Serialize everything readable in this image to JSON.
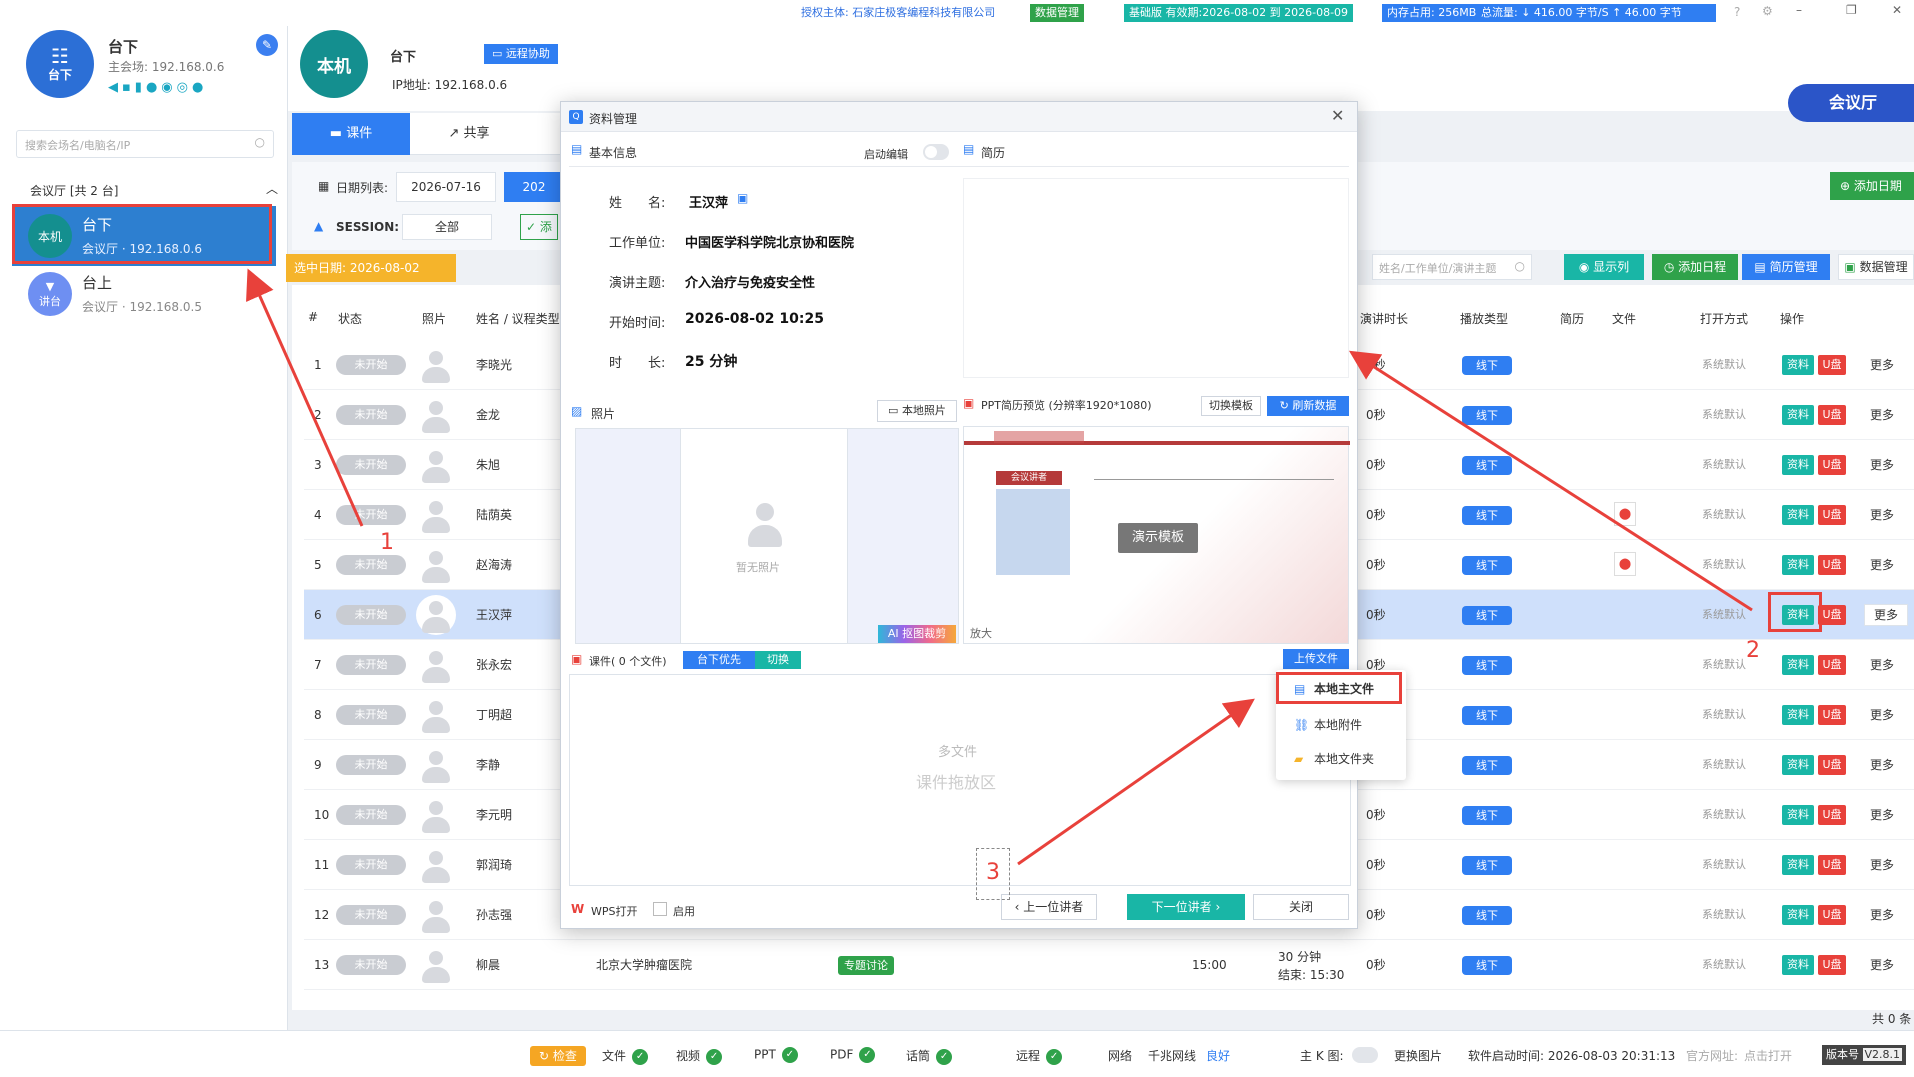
{
  "topbar": {
    "license": "授权主体: 石家庄极客编程科技有限公司",
    "data_mgmt": "数据管理",
    "edition": "基础版 有效期:2026-08-02 到 2026-08-09",
    "memory": "内存占用: 256MB",
    "traffic": "总流量: ↓ 416.00 字节/S ↑ 46.00 字节"
  },
  "sidebar": {
    "logo_label": "台下",
    "title": "台下",
    "main_venue": "主会场: 192.168.0.6",
    "search_placeholder": "搜索会场名/电脑名/IP",
    "group_title": "会议厅 [共 2 台]",
    "devices": [
      {
        "badge": "本机",
        "name": "台下",
        "sub": "会议厅 · 192.168.0.6"
      },
      {
        "badge": "讲台",
        "name": "台上",
        "sub": "会议厅 · 192.168.0.5"
      }
    ]
  },
  "header": {
    "badge": "本机",
    "name": "台下",
    "remote": "远程协助",
    "ip": "IP地址: 192.168.0.6",
    "hall_button": "会议厅"
  },
  "tabs": [
    {
      "label": "课件"
    },
    {
      "label": "共享"
    }
  ],
  "filter": {
    "date_label": "日期列表:",
    "date_value": "2026-07-16",
    "date2": "202",
    "add_date": "添加日期",
    "session_label": "SESSION:",
    "session_value": "全部",
    "add": "添",
    "selected_date": "选中日期: 2026-08-02",
    "search_placeholder": "姓名/工作单位/演讲主题",
    "show_cols": "显示列",
    "add_schedule": "添加日程",
    "resume_mgmt": "简历管理",
    "data_mgmt": "数据管理"
  },
  "table": {
    "headers": {
      "no": "#",
      "status": "状态",
      "photo": "照片",
      "name": "姓名 / 议程类型",
      "duration": "演讲时长",
      "play": "播放类型",
      "resume": "简历",
      "file": "文件",
      "open": "打开方式",
      "ops": "操作"
    },
    "rows": [
      {
        "no": "1",
        "status": "未开始",
        "name": "李晓光",
        "dur": "0秒",
        "play": "线下",
        "open": "系统默认"
      },
      {
        "no": "2",
        "status": "未开始",
        "name": "金龙",
        "dur": "0秒",
        "play": "线下",
        "open": "系统默认"
      },
      {
        "no": "3",
        "status": "未开始",
        "name": "朱旭",
        "dur": "0秒",
        "play": "线下",
        "open": "系统默认"
      },
      {
        "no": "4",
        "status": "未开始",
        "name": "陆荫英",
        "dur": "0秒",
        "play": "线下",
        "open": "系统默认"
      },
      {
        "no": "5",
        "status": "未开始",
        "name": "赵海涛",
        "dur": "0秒",
        "play": "线下",
        "open": "系统默认"
      },
      {
        "no": "6",
        "status": "未开始",
        "name": "王汉萍",
        "dur": "0秒",
        "play": "线下",
        "open": "系统默认"
      },
      {
        "no": "7",
        "status": "未开始",
        "name": "张永宏",
        "dur": "0秒",
        "play": "线下",
        "open": "系统默认"
      },
      {
        "no": "8",
        "status": "未开始",
        "name": "丁明超",
        "dur": "0秒",
        "play": "线下",
        "open": "系统默认"
      },
      {
        "no": "9",
        "status": "未开始",
        "name": "李静",
        "dur": "0秒",
        "play": "线下",
        "open": "系统默认"
      },
      {
        "no": "10",
        "status": "未开始",
        "name": "李元明",
        "dur": "0秒",
        "play": "线下",
        "open": "系统默认"
      },
      {
        "no": "11",
        "status": "未开始",
        "name": "郭润琦",
        "dur": "0秒",
        "play": "线下",
        "open": "系统默认"
      },
      {
        "no": "12",
        "status": "未开始",
        "name": "孙志强",
        "dur": "0秒",
        "play": "线下",
        "open": "系统默认"
      },
      {
        "no": "13",
        "status": "未开始",
        "name": "柳晨",
        "dur": "0秒",
        "play": "线下",
        "open": "系统默认",
        "org": "北京大学肿瘤医院",
        "tag": "专题讨论",
        "time": "15:00",
        "len": "30 分钟",
        "end": "结束: 15:30"
      }
    ],
    "btn_zl": "资料",
    "btn_up": "U盘",
    "more": "更多",
    "total": "共 0 条"
  },
  "modal": {
    "title": "资料管理",
    "basic_info": "基本信息",
    "enable_edit": "启动编辑",
    "resume": "简历",
    "fields": {
      "name_l": "姓　　名:",
      "name_v": "王汉萍",
      "org_l": "工作单位:",
      "org_v": "中国医学科学院北京协和医院",
      "topic_l": "演讲主题:",
      "topic_v": "介入治疗与免疫安全性",
      "start_l": "开始时间:",
      "start_v": "2026-08-02 10:25",
      "dur_l": "时　　长:",
      "dur_v": "25 分钟"
    },
    "photo": "照片",
    "local_photo": "本地照片",
    "no_photo": "暂无照片",
    "ai_crop": "AI 抠图裁剪",
    "ppt_preview": "PPT简历预览 (分辨率1920*1080)",
    "switch_template": "切换模板",
    "refresh_data": "刷新数据",
    "demo_template": "演示模板",
    "enlarge": "放大",
    "ppt_speaker": "会议讲者",
    "courseware": "课件( 0 个文件)",
    "prefer": "台下优先",
    "switch": "切换",
    "upload": "上传文件",
    "drop_1": "多文件",
    "drop_2": "课件拖放区",
    "wps": "WPS打开",
    "enable": "启用",
    "prev": "上一位讲者",
    "next": "下一位讲者",
    "close": "关闭"
  },
  "dropdown": [
    "本地主文件",
    "本地附件",
    "本地文件夹"
  ],
  "bottom": {
    "check": "检查",
    "file": "文件",
    "video": "视频",
    "ppt": "PPT",
    "pdf": "PDF",
    "speech": "话筒",
    "remote": "远程",
    "network": "网络",
    "gigabit": "千兆网线",
    "good": "良好",
    "main_k": "主 K 图:",
    "change_img": "更换图片",
    "start_time": "软件启动时间: 2026-08-03 20:31:13",
    "site": "官方网址:",
    "open": "点击打开",
    "version": "版本号",
    "version_num": "V2.8.1"
  },
  "annotations": [
    "1",
    "2",
    "3"
  ]
}
